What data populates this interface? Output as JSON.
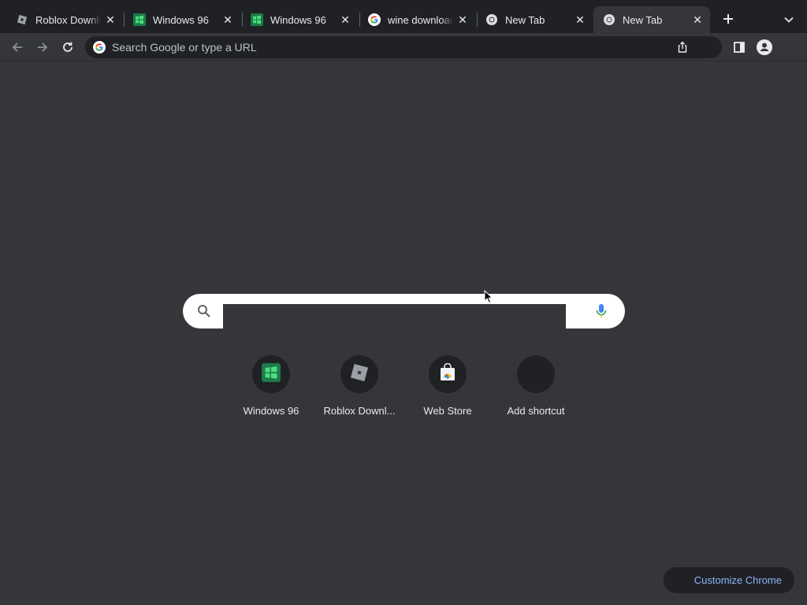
{
  "tabs": [
    {
      "title": "Roblox Downlo",
      "favicon": "roblox-icon",
      "active": false
    },
    {
      "title": "Windows 96",
      "favicon": "windows96-icon",
      "active": false
    },
    {
      "title": "Windows 96",
      "favicon": "windows96-icon",
      "active": false
    },
    {
      "title": "wine download",
      "favicon": "google-icon",
      "active": false
    },
    {
      "title": "New Tab",
      "favicon": "chrome-icon",
      "active": false
    },
    {
      "title": "New Tab",
      "favicon": "chrome-icon",
      "active": true
    }
  ],
  "omnibox": {
    "placeholder": "Search Google or type a URL"
  },
  "ntp_search": {
    "value": ""
  },
  "shortcuts": [
    {
      "label": "Windows 96",
      "icon": "windows96-icon"
    },
    {
      "label": "Roblox Downl...",
      "icon": "roblox-icon"
    },
    {
      "label": "Web Store",
      "icon": "chrome-web-store-icon"
    },
    {
      "label": "Add shortcut",
      "icon": "add-shortcut-icon"
    }
  ],
  "customize_label": "Customize Chrome",
  "colors": {
    "frame": "#202124",
    "page_background": "#35363a",
    "link_accent": "#8ab4f8"
  }
}
